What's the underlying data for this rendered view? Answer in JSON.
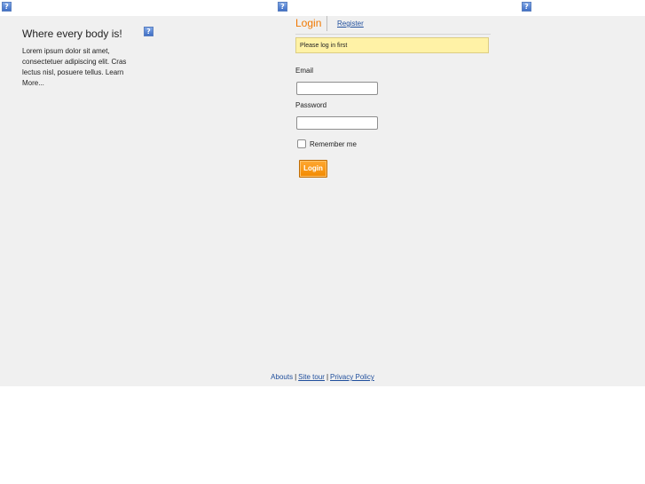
{
  "header": {
    "icons": [
      "broken-image-icon",
      "broken-image-icon",
      "broken-image-icon"
    ],
    "broken_glyph": "?"
  },
  "left": {
    "tagline": "Where every body is!",
    "blurb": "Lorem ipsum dolor sit amet, consectetuer adipiscing elit. Cras lectus nisl, posuere tellus. Learn More..."
  },
  "tabs": {
    "login": "Login",
    "register": "Register"
  },
  "notice": "Please log in first",
  "form": {
    "email_label": "Email",
    "email_value": "",
    "password_label": "Password",
    "password_value": "",
    "remember_label": "Remember me",
    "remember_checked": false,
    "submit_label": "Login"
  },
  "footer": {
    "abouts": "Abouts",
    "site_tour": "Site tour",
    "privacy": "Privacy Policy",
    "separator": "|"
  },
  "colors": {
    "accent": "#f07800",
    "link": "#1f4e9c",
    "notice_bg": "#fff2a6",
    "panel_bg": "#f0f0f0"
  }
}
